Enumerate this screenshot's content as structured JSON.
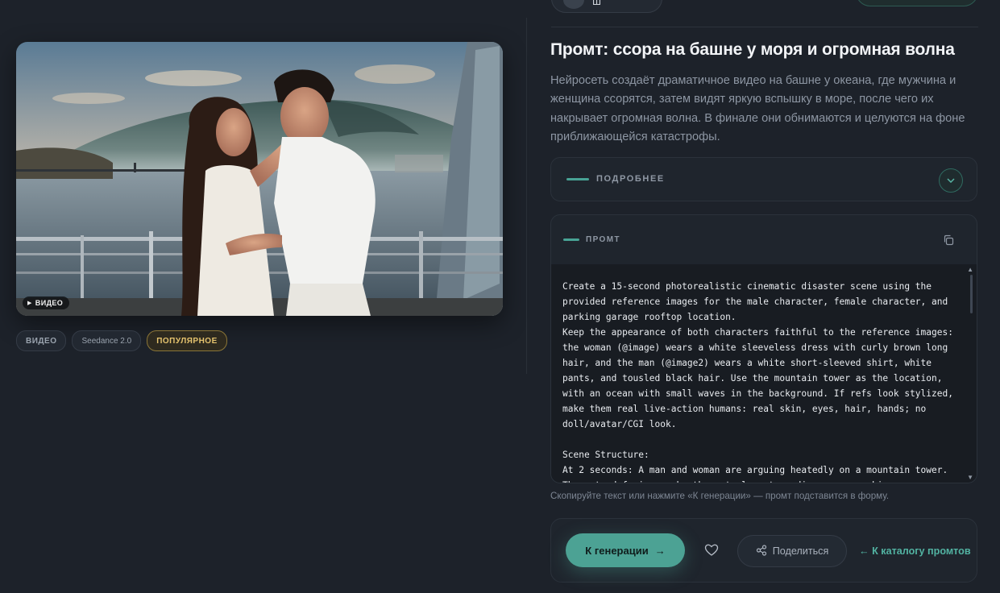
{
  "header": {
    "user_chip_text": "Ш"
  },
  "media": {
    "badge_icon": "play-icon",
    "badge_label": "ВИДЕО"
  },
  "tags": [
    {
      "label": "ВИДЕО"
    },
    {
      "label": "Seedance 2.0"
    },
    {
      "label": "ПОПУЛЯРНОЕ"
    }
  ],
  "page": {
    "title": "Промт: ссора на башне у моря и огромная волна",
    "description": "Нейросеть создаёт драматичное видео на башне у океана, где мужчина и женщина ссорятся, затем видят яркую вспышку в море, после чего их накрывает огромная волна. В финале они обнимаются и целуются на фоне приближающейся катастрофы."
  },
  "details": {
    "label": "ПОДРОБНЕЕ",
    "icon": "chevron-down-icon"
  },
  "prompt": {
    "label": "ПРОМТ",
    "copy_icon": "copy-icon",
    "text": "Create a 15-second photorealistic cinematic disaster scene using the provided reference images for the male character, female character, and parking garage rooftop location.\nKeep the appearance of both characters faithful to the reference images: the woman (@image) wears a white sleeveless dress with curly brown long hair, and the man (@image2) wears a white short-sleeved shirt, white pants, and tousled black hair. Use the mountain tower as the location, with an ocean with small waves in the background. If refs look stylized, make them real live-action humans: real skin, eyes, hair, hands; no doll/avatar/CGI look.\n\nScene Structure:\nAt 2 seconds: A man and woman are arguing heatedly on a mountain tower. They stand facing each other at close to medium range, making angry facial expressions, sharp hand gestures, tense eye contact, and emotionally"
  },
  "hint": "Скопируйте текст или нажмите «К генерации» — промт подставится в форму.",
  "actions": {
    "generate_label": "К генерации",
    "generate_arrow": "→",
    "favorite_icon": "heart-icon",
    "share_label": "Поделиться",
    "share_icon": "share-icon",
    "back_label": "← К каталогу промтов"
  },
  "colors": {
    "accent": "#4ca294",
    "background": "#1d222a",
    "popular": "#e5c36e"
  }
}
